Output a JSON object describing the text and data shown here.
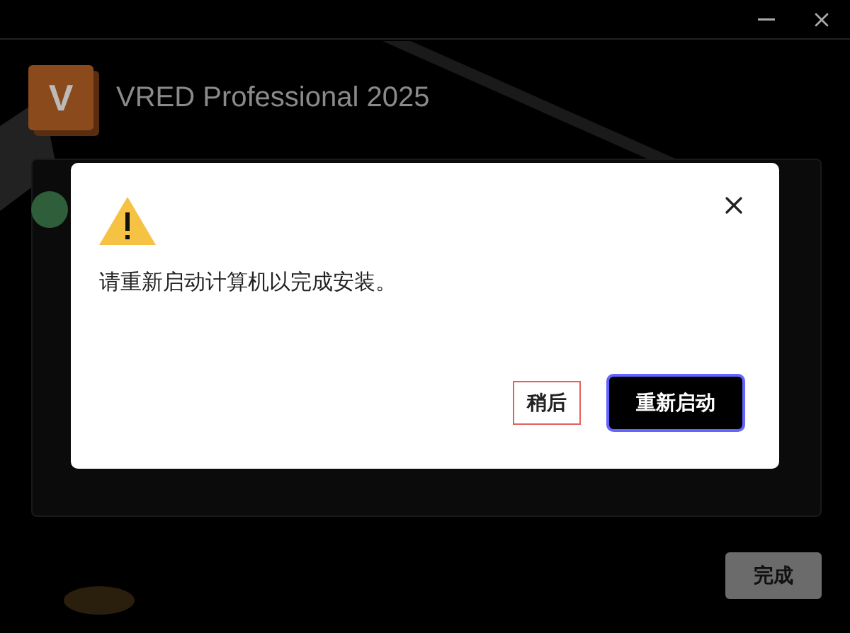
{
  "window": {
    "title": "VRED Professional 2025",
    "logo_letter": "V"
  },
  "dialog": {
    "message": "请重新启动计算机以完成安装。",
    "buttons": [
      {
        "label": "稍后",
        "kind": "secondary"
      },
      {
        "label": "重新启动",
        "kind": "primary"
      }
    ]
  },
  "footer": {
    "button": "完成",
    "disabled": true
  }
}
